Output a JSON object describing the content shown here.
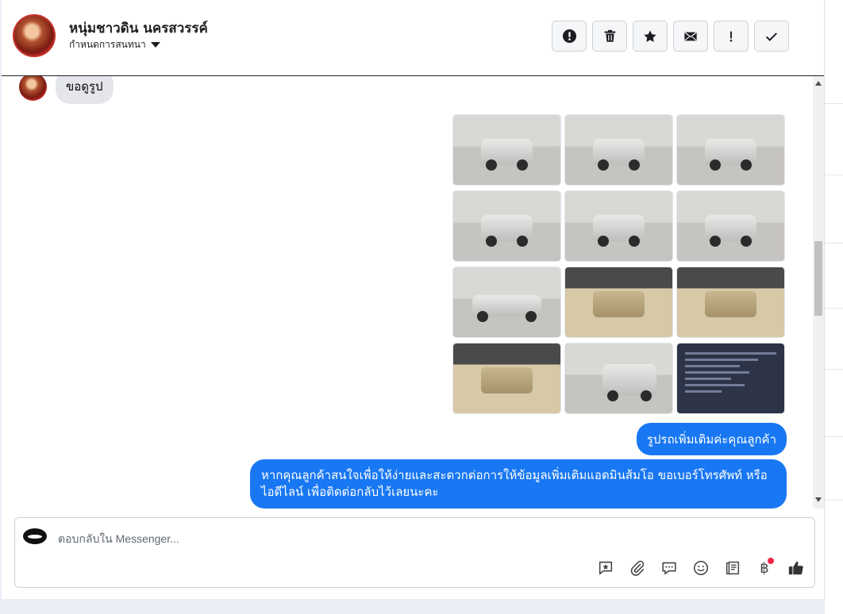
{
  "header": {
    "contact_name": "หนุ่มชาวดิน นครสวรรค์",
    "assign_label": "กำหนดการสนทนา",
    "actions": [
      {
        "name": "spam-button",
        "icon": "alert-circle-icon"
      },
      {
        "name": "delete-button",
        "icon": "trash-icon"
      },
      {
        "name": "star-button",
        "icon": "star-icon"
      },
      {
        "name": "mark-unread-button",
        "icon": "envelope-icon"
      },
      {
        "name": "follow-up-button",
        "icon": "exclamation-icon"
      },
      {
        "name": "mark-done-button",
        "icon": "checkmark-icon"
      }
    ]
  },
  "conversation": {
    "incoming_message": "ขอดูรูป",
    "gallery": [
      {
        "kind": "car"
      },
      {
        "kind": "car"
      },
      {
        "kind": "car"
      },
      {
        "kind": "car"
      },
      {
        "kind": "car"
      },
      {
        "kind": "car"
      },
      {
        "kind": "car"
      },
      {
        "kind": "interior"
      },
      {
        "kind": "interior"
      },
      {
        "kind": "interior"
      },
      {
        "kind": "car"
      },
      {
        "kind": "document"
      }
    ],
    "outgoing_messages": [
      "รูปรถเพิ่มเติมค่ะคุณลูกค้า",
      "หากคุณลูกค้าสนใจเพื่อให้ง่ายและสะดวกต่อการให้ข้อมูลเพิ่มเติมแอดมินส้มโอ ขอเบอร์โทรศัพท์ หรือ ไอดีไลน์ เพื่อติดต่อกลับไว้เลยนะคะ"
    ]
  },
  "composer": {
    "placeholder": "ตอบกลับใน Messenger...",
    "tools": [
      "saved-reply-icon",
      "attachment-icon",
      "chat-bubble-icon",
      "emoji-icon",
      "notes-icon",
      "baht-icon",
      "thumbs-up-icon"
    ],
    "baht_symbol": "฿"
  },
  "colors": {
    "accent": "#1877f2",
    "incoming_bubble": "#e4e6eb",
    "notification": "#f02849"
  }
}
